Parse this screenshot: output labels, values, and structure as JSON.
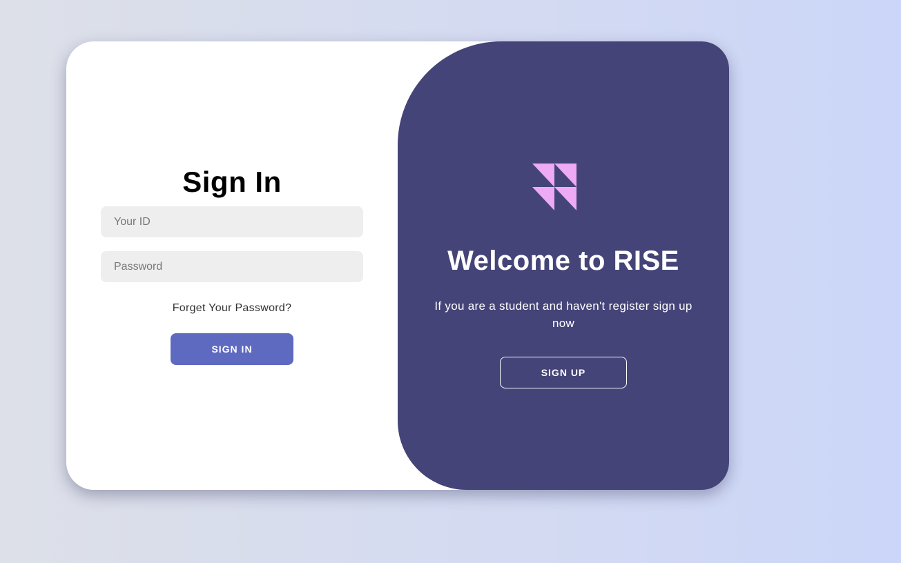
{
  "colors": {
    "panel_bg": "#454478",
    "primary_button": "#5e6abf",
    "logo_accent": "#eeaaf5",
    "field_bg": "#eeeeee"
  },
  "signin": {
    "title": "Sign In",
    "id_placeholder": "Your ID",
    "password_placeholder": "Password",
    "forgot_label": "Forget Your Password?",
    "button_label": "SIGN IN"
  },
  "welcome": {
    "logo_icon": "rise-logo-icon",
    "title": "Welcome to RISE",
    "message": "If you are a student and haven't register sign up now",
    "button_label": "SIGN UP"
  }
}
